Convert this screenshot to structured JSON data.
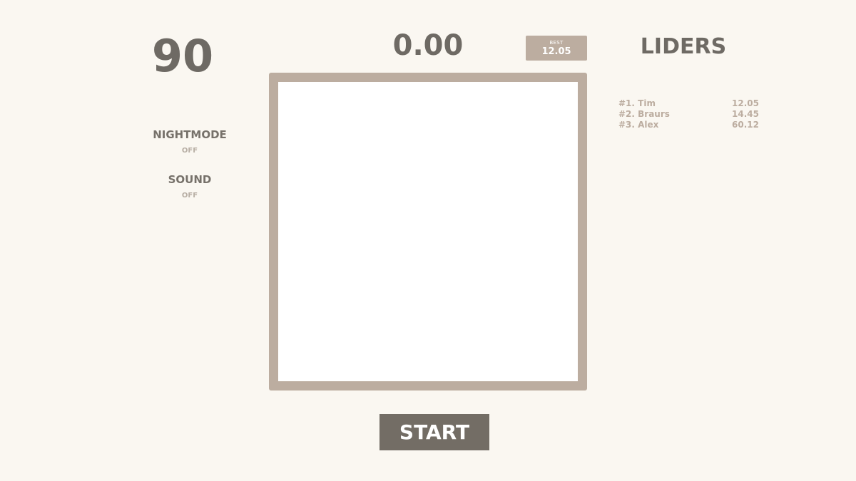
{
  "counter": {
    "value": "90"
  },
  "settings": {
    "nightmode": {
      "label": "NIGHTMODE",
      "value": "OFF"
    },
    "sound": {
      "label": "SOUND",
      "value": "OFF"
    }
  },
  "timer": {
    "value": "0.00"
  },
  "best": {
    "label": "BEST",
    "value": "12.05"
  },
  "board": {
    "frame_color": "#bcada0",
    "cell_color": "#ffffff"
  },
  "start_button": {
    "label": "START"
  },
  "leaders": {
    "title": "LIDERS",
    "entries": [
      {
        "name": "#1. Tim",
        "score": "12.05"
      },
      {
        "name": "#2. Braurs",
        "score": "14.45"
      },
      {
        "name": "#3. Alex",
        "score": "60.12"
      }
    ]
  }
}
